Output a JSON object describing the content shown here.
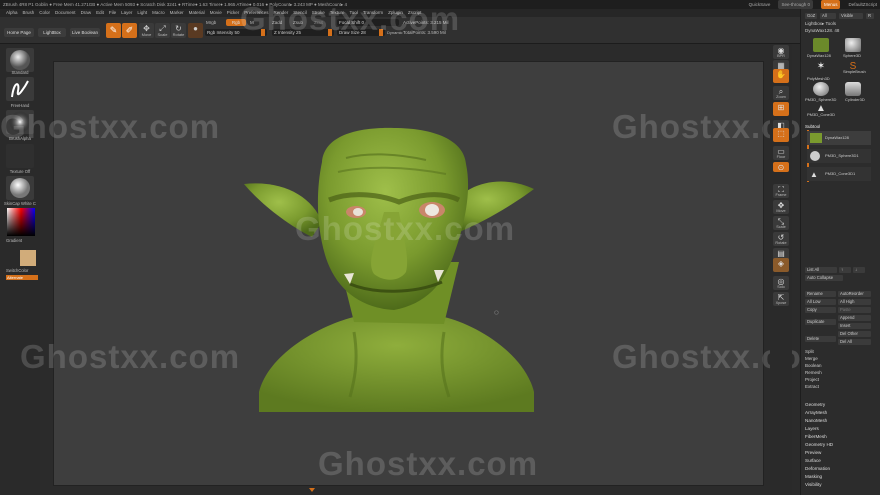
{
  "titlebar": {
    "left": "ZBrush 4R8 P1   Goblin ● Free Mem 41.271GB ● Active Mem 5093 ● Scratch Disk 3241 ● RTime● 1.63 Timer● 1.965 ATime● 0.016 ● PolyCount▸ 3.243 MP ● MeshCount▸ 4",
    "quicksave": "QuickSave",
    "seethrough": "See-through  0",
    "menus_label": "Menus",
    "script": "DefaultZScript"
  },
  "menubar": [
    "Alpha",
    "Brush",
    "Color",
    "Document",
    "Draw",
    "Edit",
    "File",
    "Layer",
    "Light",
    "Macro",
    "Marker",
    "Material",
    "Movie",
    "Picker",
    "Preferences",
    "Render",
    "Stencil",
    "Stroke",
    "Texture",
    "Tool",
    "Transform",
    "Zplugin",
    "Zscript"
  ],
  "toolbar": {
    "home_page": "Home Page",
    "lightbox": "LightBox",
    "live_boolean": "Live Boolean",
    "edit": "Edit",
    "draw": "Draw",
    "move": "Move",
    "scale": "Scale",
    "rotate": "Rotate",
    "mrgb": "Mrgb",
    "rgb": "Rgb",
    "m": "M",
    "zadd": "Zadd",
    "zsub": "Zsub",
    "zcut": "Zcut",
    "focal_shift": "Focal Shift 0",
    "active_points": "ActivePoints: 3.215 Mil",
    "rgb_intensity": "Rgb Intensity 50",
    "z_intensity": "Z Intensity 25",
    "draw_size": "Draw Size 28",
    "dynamic": "Dynamic",
    "total_points": "TotalPoints: 3.590 Mil"
  },
  "left_shelf": {
    "brush1": "Standard",
    "brush2": "FreeHand",
    "brush3": "BrushAlpha",
    "texture": "Texture Off",
    "material": "SkinCap White C",
    "gradient": "Gradient",
    "switch_color": "SwitchColor",
    "alternate": "Alternate"
  },
  "right_shelf": [
    "BPR",
    "SPix 3",
    "",
    "Scroll",
    "Zoom",
    "Actual",
    "AAHalf",
    "",
    "Persp",
    "Floor",
    "Local",
    "",
    "Frame",
    "Move",
    "Scale",
    "Rotate",
    "Line Fill PolyF",
    "Transp",
    "Ghost",
    "",
    "Solo",
    "Xpose"
  ],
  "tray": {
    "goz": "GoZ",
    "all": "All",
    "visible": "Visible",
    "r": "R",
    "lightbox_tools": "Lightbox▸ Tools",
    "current_tool": "DynaWax128.  48",
    "tools": [
      "DynaWax128",
      "Sphere3D",
      "PolyMesh3D",
      "SimpleBrush",
      "PM3D_Sphere3D",
      "Cylinder3D",
      "PM3D_Cone3D"
    ],
    "subtool_title": "Subtool",
    "subtools": [
      "DynaWax128",
      "PM3D_Sphere3D1",
      "PM3D_Cone3D1"
    ],
    "list_all": "List All",
    "auto_collapse": "Auto Collapse",
    "rename": "Rename",
    "autoreorder": "AutoReorder",
    "all_low": "All Low",
    "all_high": "All High",
    "copy": "Copy",
    "paste": "Paste",
    "duplicate": "Duplicate",
    "append": "Append",
    "insert": "Insert",
    "delete": "Delete",
    "del_other": "Del Other",
    "del_all": "Del All",
    "split": "Split",
    "merge": "Merge",
    "boolean": "Boolean",
    "remesh": "Remesh",
    "project": "Project",
    "extract": "Extract",
    "sections": [
      "Geometry",
      "ArrayMesh",
      "NanoMesh",
      "Layers",
      "FiberMesh",
      "Geometry HD",
      "Preview",
      "Surface",
      "Deformation",
      "Masking",
      "Visibility"
    ]
  },
  "watermark": "Ghostxx.com",
  "colors": {
    "accent": "#d5701a",
    "background": "#2b2b2b",
    "viewport": "#3e3e3e",
    "model_green": "#7a9a2e"
  }
}
